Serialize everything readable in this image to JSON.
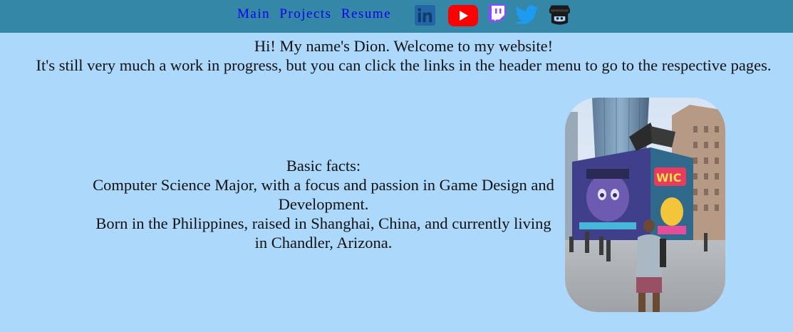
{
  "nav": {
    "links": [
      "Main",
      "Projects",
      "Resume"
    ]
  },
  "social": {
    "icons": [
      "linkedin-icon",
      "youtube-icon",
      "twitch-icon",
      "twitter-icon",
      "itchio-icon"
    ],
    "colors": {
      "linkedin": "#2467a8",
      "youtube": "#ff0000",
      "twitch": "#9146ff",
      "twitter": "#1d9bf0",
      "itchio": "#1a1a1a"
    }
  },
  "intro": {
    "line1": "Hi! My name's Dion. Welcome to my website!",
    "line2": "It's still very much a work in progress, but you can click the links in the header menu to go to the respective pages."
  },
  "facts": {
    "heading": "Basic facts:",
    "major": "Computer Science Major, with a focus and passion in Game Design and Development.",
    "origin": "Born in the Philippines, raised in Shanghai, China, and currently living in Chandler, Arizona."
  },
  "colors": {
    "header_bg": "#3487a6",
    "page_bg": "#acd8fb",
    "link": "#0000ee"
  }
}
